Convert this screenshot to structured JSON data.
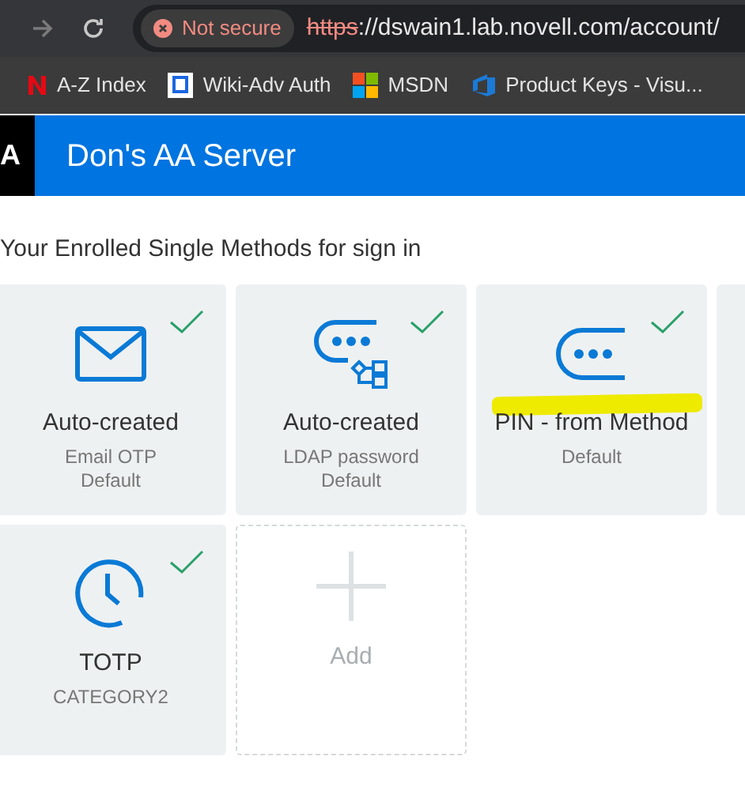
{
  "browser": {
    "security_label": "Not secure",
    "url_scheme": "https",
    "url_rest": "://dswain1.lab.novell.com/account/"
  },
  "bookmarks": [
    {
      "kind": "n",
      "label": "A-Z Index"
    },
    {
      "kind": "square",
      "label": "Wiki-Adv Auth"
    },
    {
      "kind": "windows",
      "label": "MSDN"
    },
    {
      "kind": "devops",
      "label": "Product Keys - Visu..."
    }
  ],
  "header": {
    "logo": "A",
    "title": "Don's AA Server"
  },
  "section_title": "Your Enrolled Single Methods for sign in",
  "methods": [
    {
      "kind": "email",
      "title": "Auto-created",
      "lines": [
        "Email OTP",
        "Default"
      ],
      "enrolled": true,
      "highlighted": false
    },
    {
      "kind": "ldap",
      "title": "Auto-created",
      "lines": [
        "LDAP password",
        "Default"
      ],
      "enrolled": true,
      "highlighted": false
    },
    {
      "kind": "pin",
      "title": "PIN - from Method",
      "lines": [
        "Default"
      ],
      "enrolled": true,
      "highlighted": true
    },
    {
      "kind": "partial"
    },
    {
      "kind": "totp",
      "title": "TOTP",
      "lines": [
        "CATEGORY2"
      ],
      "enrolled": true,
      "highlighted": false
    },
    {
      "kind": "add",
      "title": "Add"
    }
  ]
}
